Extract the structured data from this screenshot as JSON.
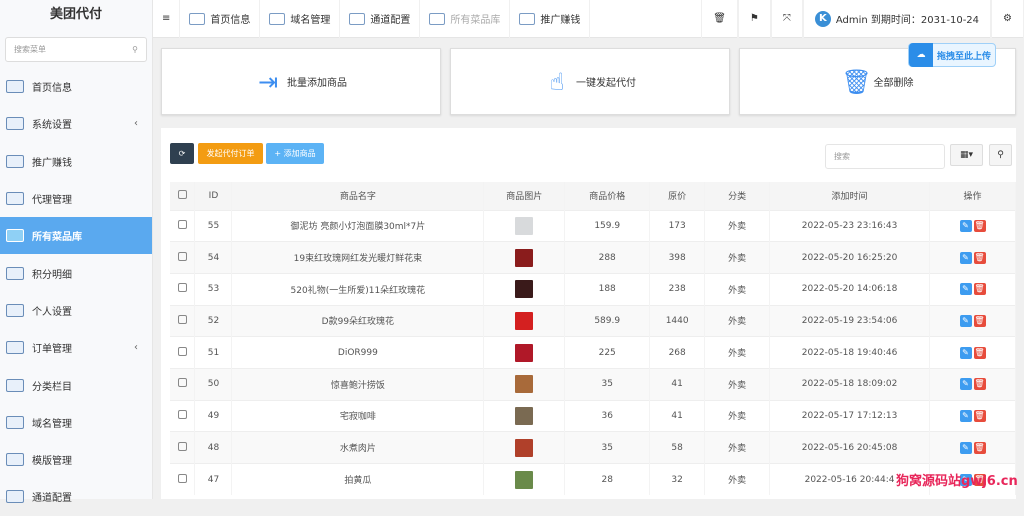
{
  "sidebar": {
    "logo": "美团代付",
    "search_placeholder": "搜索菜单",
    "items": [
      {
        "label": "首页信息"
      },
      {
        "label": "系统设置",
        "arrow": "‹"
      },
      {
        "label": "推广赚钱"
      },
      {
        "label": "代理管理"
      },
      {
        "label": "所有菜品库",
        "active": true
      },
      {
        "label": "积分明细"
      },
      {
        "label": "个人设置"
      },
      {
        "label": "订单管理",
        "arrow": "‹"
      },
      {
        "label": "分类栏目"
      },
      {
        "label": "域名管理"
      },
      {
        "label": "模版管理"
      },
      {
        "label": "通道配置"
      }
    ]
  },
  "topbar": {
    "menu_icon": "≡",
    "tabs": [
      {
        "label": "首页信息"
      },
      {
        "label": "域名管理"
      },
      {
        "label": "通道配置"
      },
      {
        "label": "所有菜品库",
        "dim": true
      },
      {
        "label": "推广赚钱"
      }
    ],
    "user": "Admin 到期时间：2031-10-24",
    "avatar_letter": "K"
  },
  "cards": [
    {
      "label": "批量添加商品",
      "icon": "⇥"
    },
    {
      "label": "一键发起代付",
      "icon": "☝"
    },
    {
      "label": "全部删除",
      "icon": "🗑"
    }
  ],
  "upload_label": "拖拽至此上传",
  "toolbar": {
    "order_btn": "发起代付订单",
    "add_btn": "+ 添加商品",
    "search_placeholder": "搜索"
  },
  "table": {
    "headers": [
      "ID",
      "商品名字",
      "商品图片",
      "商品价格",
      "原价",
      "分类",
      "添加时间",
      "操作"
    ],
    "rows": [
      {
        "id": "55",
        "name": "御泥坊 亮颜小灯泡面膜30ml*7片",
        "price": "159.9",
        "orig": "173",
        "cat": "外卖",
        "time": "2022-05-23 23:16:43",
        "img": "#d8dadc"
      },
      {
        "id": "54",
        "name": "19束红玫瑰网红发光暖灯鲜花束",
        "price": "288",
        "orig": "398",
        "cat": "外卖",
        "time": "2022-05-20 16:25:20",
        "img": "#8a1c1c"
      },
      {
        "id": "53",
        "name": "520礼物(一生所爱)11朵红玫瑰花",
        "price": "188",
        "orig": "238",
        "cat": "外卖",
        "time": "2022-05-20 14:06:18",
        "img": "#3a1a1a"
      },
      {
        "id": "52",
        "name": "D款99朵红玫瑰花",
        "price": "589.9",
        "orig": "1440",
        "cat": "外卖",
        "time": "2022-05-19 23:54:06",
        "img": "#d42020"
      },
      {
        "id": "51",
        "name": "DiOR999",
        "price": "225",
        "orig": "268",
        "cat": "外卖",
        "time": "2022-05-18 19:40:46",
        "img": "#b01828"
      },
      {
        "id": "50",
        "name": "惊喜鲍汁捞饭",
        "price": "35",
        "orig": "41",
        "cat": "外卖",
        "time": "2022-05-18 18:09:02",
        "img": "#a86a3a"
      },
      {
        "id": "49",
        "name": "宅寂咖啡",
        "price": "36",
        "orig": "41",
        "cat": "外卖",
        "time": "2022-05-17 17:12:13",
        "img": "#7a6a52"
      },
      {
        "id": "48",
        "name": "水煮肉片",
        "price": "35",
        "orig": "58",
        "cat": "外卖",
        "time": "2022-05-16 20:45:08",
        "img": "#b0402a"
      },
      {
        "id": "47",
        "name": "拍黄瓜",
        "price": "28",
        "orig": "32",
        "cat": "外卖",
        "time": "2022-05-16 20:44:4",
        "img": "#6a8a4a"
      }
    ]
  },
  "watermark": "狗窝源码站gwj6.cn"
}
